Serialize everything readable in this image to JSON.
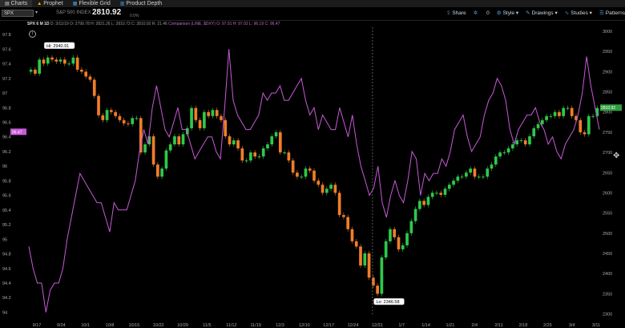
{
  "tabs": [
    {
      "label": "Charts",
      "icon": "chart-icon",
      "active": true
    },
    {
      "label": "Prophet",
      "icon": "warning-icon",
      "active": false
    },
    {
      "label": "Flexible Grid",
      "icon": "grid-icon",
      "active": false
    },
    {
      "label": "Product Depth",
      "icon": "depth-icon",
      "active": false
    }
  ],
  "toolbar": {
    "symbol": "SPX",
    "symbol_desc": "S&P 500 INDEX",
    "last_price": "2810.92",
    "change_text": "0.0%",
    "share": "Share",
    "count": "0",
    "style": "Style",
    "drawings": "Drawings",
    "studies": "Studies",
    "patterns": "Patterns"
  },
  "header": {
    "title": "SPX 6 M 1D",
    "ohlc": "D: 3/11/19  O: 2799.78  H: 2821.26  L: 2810.73  C: 2810.92  R: 21.46",
    "comparison": "Comparison (LINE, $DXY)  O: 97.01  H: 97.02  L: 96.19  C: 96.47"
  },
  "labels": {
    "hi": "Hi: 2940.91",
    "lo": "Lo: 2346.58",
    "left_tag": "96.47",
    "right_tag": "2810.92"
  },
  "colors": {
    "up": "#2fc84a",
    "down": "#f07d2a",
    "comparison": "#c85ad8",
    "grid": "#2e2e2e"
  },
  "chart_data": {
    "type": "line",
    "x_ticks": [
      "9/17",
      "9/24",
      "10/1",
      "10/8",
      "10/15",
      "10/22",
      "10/29",
      "11/5",
      "11/12",
      "11/19",
      "12/3",
      "12/10",
      "12/17",
      "12/24",
      "12/31",
      "1/7",
      "1/14",
      "1/21",
      "2/4",
      "2/11",
      "2/18",
      "2/25",
      "3/4",
      "3/11"
    ],
    "left_ticks": [
      "97.8",
      "97.6",
      "97.4",
      "97.2",
      "97",
      "96.8",
      "96.6",
      "96.4",
      "96.2",
      "96",
      "95.8",
      "95.6",
      "95.4",
      "95.2",
      "95",
      "94.8",
      "94.6",
      "94.4",
      "94.2",
      "94"
    ],
    "right_ticks": [
      "3000",
      "2950",
      "2900",
      "2850",
      "2800",
      "2750",
      "2700",
      "2650",
      "2600",
      "2550",
      "2500",
      "2450",
      "2400",
      "2350",
      "2300"
    ],
    "left_ylim": [
      93.95,
      97.9
    ],
    "right_ylim": [
      2295,
      3010
    ],
    "hi_value": 2940.91,
    "lo_value": 2346.58,
    "series": [
      {
        "name": "SPX",
        "kind": "candlestick",
        "axis": "right",
        "close": [
          2905,
          2895,
          2930,
          2920,
          2935,
          2930,
          2925,
          2930,
          2920,
          2920,
          2935,
          2905,
          2900,
          2888,
          2880,
          2840,
          2792,
          2780,
          2805,
          2800,
          2790,
          2780,
          2772,
          2770,
          2785,
          2785,
          2700,
          2720,
          2740,
          2670,
          2640,
          2660,
          2705,
          2720,
          2740,
          2720,
          2745,
          2760,
          2810,
          2780,
          2760,
          2800,
          2790,
          2805,
          2790,
          2780,
          2740,
          2720,
          2730,
          2710,
          2680,
          2680,
          2700,
          2690,
          2690,
          2710,
          2720,
          2740,
          2750,
          2700,
          2700,
          2680,
          2650,
          2640,
          2640,
          2660,
          2655,
          2630,
          2620,
          2600,
          2610,
          2620,
          2600,
          2545,
          2540,
          2510,
          2480,
          2467,
          2420,
          2450,
          2390,
          2370,
          2350,
          2440,
          2480,
          2510,
          2490,
          2460,
          2470,
          2500,
          2530,
          2560,
          2580,
          2570,
          2590,
          2600,
          2600,
          2595,
          2610,
          2620,
          2630,
          2640,
          2640,
          2650,
          2660,
          2640,
          2640,
          2640,
          2660,
          2670,
          2690,
          2700,
          2700,
          2710,
          2720,
          2730,
          2730,
          2720,
          2740,
          2760,
          2770,
          2780,
          2790,
          2790,
          2800,
          2790,
          2810,
          2810,
          2790,
          2780,
          2750,
          2745,
          2790,
          2790,
          2810
        ]
      },
      {
        "name": "$DXY",
        "kind": "line",
        "axis": "left",
        "values": [
          94.9,
          94.6,
          94.4,
          94.4,
          94.0,
          94.3,
          94.4,
          94.4,
          94.6,
          95.0,
          95.3,
          95.6,
          95.9,
          95.8,
          95.7,
          95.6,
          95.5,
          95.5,
          95.3,
          95.1,
          95.5,
          95.4,
          95.4,
          95.4,
          95.6,
          95.8,
          96.2,
          96.5,
          96.3,
          96.8,
          97.1,
          96.8,
          96.5,
          96.4,
          96.6,
          96.8,
          96.5,
          96.5,
          96.3,
          96.1,
          96.2,
          96.3,
          96.4,
          96.4,
          96.2,
          96.1,
          96.8,
          97.6,
          96.9,
          96.7,
          96.6,
          96.5,
          96.5,
          96.6,
          96.7,
          97.0,
          96.9,
          97.0,
          97.0,
          97.1,
          96.9,
          96.9,
          97.0,
          97.1,
          97.2,
          96.9,
          96.7,
          96.8,
          96.5,
          96.7,
          96.6,
          96.5,
          96.5,
          96.8,
          96.6,
          96.4,
          96.7,
          96.3,
          96.0,
          95.8,
          95.6,
          95.7,
          96.0,
          95.5,
          95.3,
          95.6,
          95.8,
          95.6,
          95.5,
          95.8,
          96.2,
          96.1,
          95.6,
          95.9,
          95.8,
          95.9,
          95.9,
          96.1,
          96.0,
          96.2,
          96.5,
          96.6,
          96.7,
          96.4,
          96.2,
          96.3,
          96.4,
          96.7,
          96.9,
          97.0,
          97.2,
          97.1,
          96.9,
          96.5,
          96.3,
          96.5,
          96.6,
          96.7,
          96.7,
          96.8,
          96.6,
          96.5,
          96.3,
          96.4,
          96.2,
          96.1,
          96.3,
          96.4,
          96.5,
          96.7,
          97.0,
          97.5,
          97.1,
          96.8,
          96.5
        ]
      }
    ]
  }
}
